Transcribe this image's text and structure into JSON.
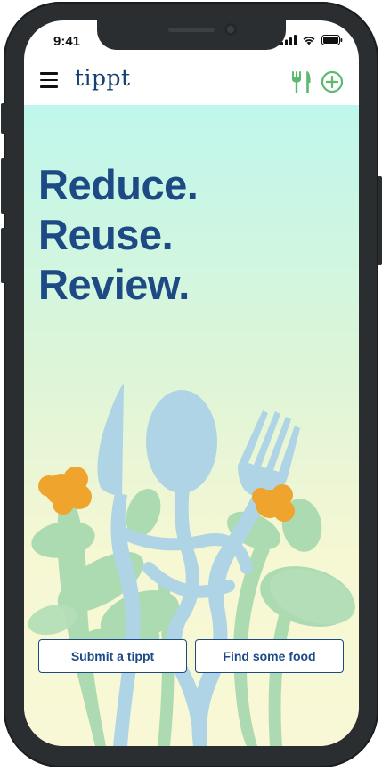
{
  "status": {
    "time": "9:41"
  },
  "app": {
    "logo": "tippt"
  },
  "hero": {
    "lines": [
      "Reduce.",
      "Reuse.",
      "Review."
    ]
  },
  "actions": {
    "submit_label": "Submit a tippt",
    "find_label": "Find some food"
  },
  "colors": {
    "brand_blue": "#1d4a84",
    "accent_green": "#5cba6e",
    "utensil_blue": "#aed4e6",
    "leaf_green": "#a9d9b0",
    "flower_orange": "#eea42d"
  },
  "icons": {
    "menu": "hamburger-icon",
    "restaurant": "fork-knife-icon",
    "add": "plus-circle-icon"
  }
}
